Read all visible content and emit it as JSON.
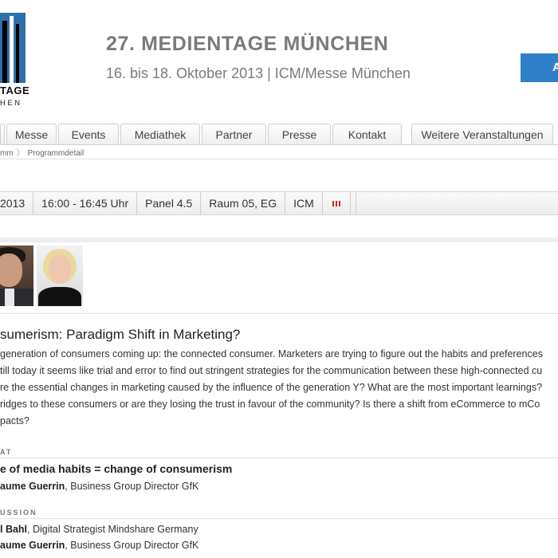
{
  "logo": {
    "line1": "TAGE",
    "line2": "HEN"
  },
  "header": {
    "title": "27. MEDIENTAGE MÜNCHEN",
    "subtitle": "16. bis 18. Oktober 2013 | ICM/Messe München",
    "cta_label": "A"
  },
  "nav": {
    "tabs": [
      {
        "label": ""
      },
      {
        "label": "Messe"
      },
      {
        "label": "Events"
      },
      {
        "label": "Mediathek"
      },
      {
        "label": "Partner"
      },
      {
        "label": "Presse"
      },
      {
        "label": "Kontakt"
      },
      {
        "label": "Weitere Veranstaltungen"
      }
    ]
  },
  "breadcrumb": {
    "parent": "mm",
    "current": "Programmdetail"
  },
  "session": {
    "date": "2013",
    "time": "16:00 - 16:45 Uhr",
    "panel": "Panel 4.5",
    "room": "Raum 05, EG",
    "venue": "ICM",
    "title": "sumerism: Paradigm Shift in Marketing?",
    "description": [
      "generation of consumers coming up: the connected consumer. Marketers are trying to figure out the habits and preferences",
      "till today it seems like trial and error to find out stringent strategies for the communication between these high-connected cu",
      "re the essential changes in marketing caused by the influence of the generation Y? What are the most important learnings?",
      "ridges to these consumers or are they losing the trust in favour of the community? Is there a shift from eCommerce to mCo",
      "pacts?"
    ]
  },
  "keynote": {
    "label": "AT",
    "title": "e of media habits = change of consumerism",
    "speaker_name": "aume Guerrin",
    "speaker_role": ", Business Group Director GfK"
  },
  "discussion": {
    "label": "USSION",
    "people": [
      {
        "name": "l Bahl",
        "role": ", Digital Strategist Mindshare Germany"
      },
      {
        "name": "aume Guerrin",
        "role": ", Business Group Director GfK"
      }
    ]
  },
  "colors": {
    "brand_blue": "#2f6fad",
    "cta_blue": "#2f7fc9",
    "title_grey": "#7a7a7a"
  }
}
